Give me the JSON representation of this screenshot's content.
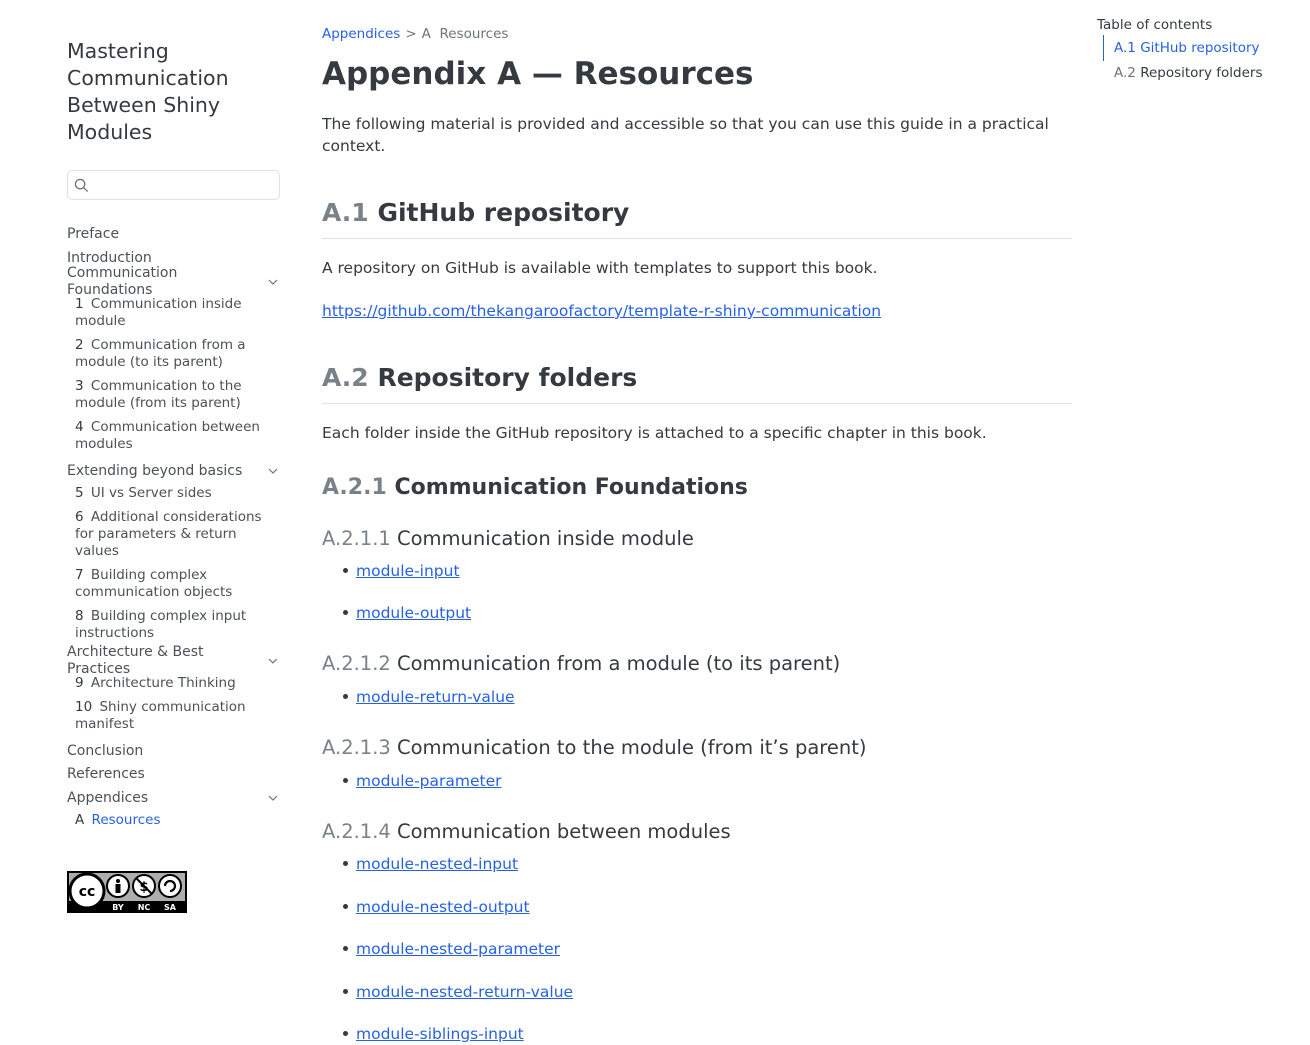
{
  "sidebar": {
    "book_title": "Mastering Communication Between Shiny Modules",
    "search_placeholder": "",
    "items": {
      "preface": "Preface",
      "introduction": "Introduction",
      "part1": "Communication Foundations",
      "part2": "Extending beyond basics",
      "part3": "Architecture & Best Practices",
      "conclusion": "Conclusion",
      "references": "References",
      "appendices": "Appendices"
    },
    "chapters": {
      "c1": {
        "num": "1",
        "label": "Communication inside module"
      },
      "c2": {
        "num": "2",
        "label": "Communication from a module (to its parent)"
      },
      "c3": {
        "num": "3",
        "label": "Communication to the module (from its parent)"
      },
      "c4": {
        "num": "4",
        "label": "Communication between modules"
      },
      "c5": {
        "num": "5",
        "label": "UI vs Server sides"
      },
      "c6": {
        "num": "6",
        "label": "Additional considerations for parameters & return values"
      },
      "c7": {
        "num": "7",
        "label": "Building complex communication objects"
      },
      "c8": {
        "num": "8",
        "label": "Building complex input instructions"
      },
      "c9": {
        "num": "9",
        "label": "Architecture Thinking"
      },
      "c10": {
        "num": "10",
        "label": "Shiny communication manifest"
      },
      "cA": {
        "num": "A",
        "label": "Resources"
      }
    },
    "license_badge": {
      "by": "BY",
      "nc": "NC",
      "sa": "SA",
      "cc": "cc"
    }
  },
  "main": {
    "breadcrumb": {
      "root": "Appendices",
      "sep": ">",
      "current_num": "A",
      "current": "Resources"
    },
    "title": "Appendix A — Resources",
    "intro": "The following material is provided and accessible so that you can use this guide in a practical context.",
    "s1": {
      "num": "A.1",
      "title": "GitHub repository",
      "text": "A repository on GitHub is available with templates to support this book.",
      "url": "https://github.com/thekangaroofactory/template-r-shiny-communication"
    },
    "s2": {
      "num": "A.2",
      "title": "Repository folders",
      "text": "Each folder inside the GitHub repository is attached to a specific chapter in this book."
    },
    "s21": {
      "num": "A.2.1",
      "title": "Communication Foundations"
    },
    "s211": {
      "num": "A.2.1.1",
      "title": "Communication inside module",
      "links": [
        "module-input",
        "module-output"
      ]
    },
    "s212": {
      "num": "A.2.1.2",
      "title": "Communication from a module (to its parent)",
      "links": [
        "module-return-value"
      ]
    },
    "s213": {
      "num": "A.2.1.3",
      "title": "Communication to the module (from it’s parent)",
      "links": [
        "module-parameter"
      ]
    },
    "s214": {
      "num": "A.2.1.4",
      "title": "Communication between modules",
      "links": [
        "module-nested-input",
        "module-nested-output",
        "module-nested-parameter",
        "module-nested-return-value",
        "module-siblings-input"
      ]
    }
  },
  "toc": {
    "title": "Table of contents",
    "items": [
      {
        "num": "A.1",
        "label": "GitHub repository"
      },
      {
        "num": "A.2",
        "label": "Repository folders"
      }
    ]
  },
  "colors": {
    "accent": "#2761e3",
    "text": "#343a40",
    "muted": "#6c757d"
  }
}
